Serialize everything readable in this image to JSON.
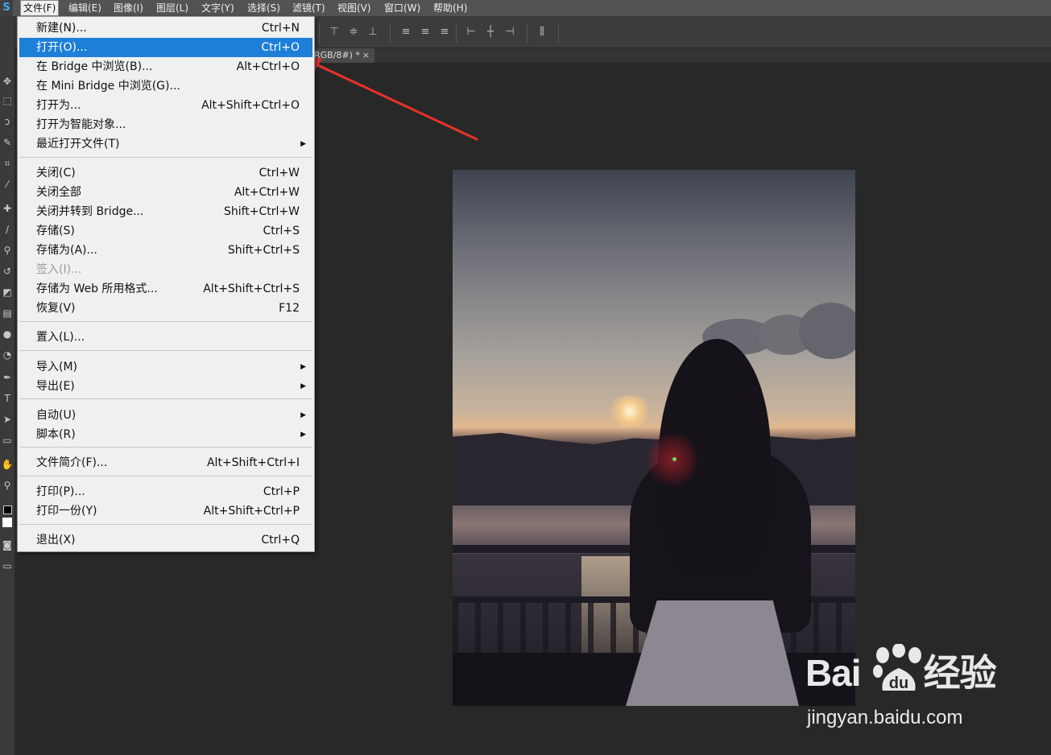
{
  "app": {
    "logo": "S"
  },
  "menubar": {
    "items": [
      {
        "label": "文件(F)",
        "active": true
      },
      {
        "label": "编辑(E)"
      },
      {
        "label": "图像(I)"
      },
      {
        "label": "图层(L)"
      },
      {
        "label": "文字(Y)"
      },
      {
        "label": "选择(S)"
      },
      {
        "label": "滤镜(T)"
      },
      {
        "label": "视图(V)"
      },
      {
        "label": "窗口(W)"
      },
      {
        "label": "帮助(H)"
      }
    ]
  },
  "document_tab": {
    "title": "RGB/8#) *",
    "close": "×"
  },
  "file_menu": {
    "items": [
      {
        "label": "新建(N)...",
        "shortcut": "Ctrl+N"
      },
      {
        "label": "打开(O)...",
        "shortcut": "Ctrl+O",
        "highlighted": true
      },
      {
        "label": "在 Bridge 中浏览(B)...",
        "shortcut": "Alt+Ctrl+O"
      },
      {
        "label": "在 Mini Bridge 中浏览(G)...",
        "shortcut": ""
      },
      {
        "label": "打开为...",
        "shortcut": "Alt+Shift+Ctrl+O"
      },
      {
        "label": "打开为智能对象...",
        "shortcut": ""
      },
      {
        "label": "最近打开文件(T)",
        "shortcut": "",
        "submenu": true
      },
      {
        "label": "关闭(C)",
        "shortcut": "Ctrl+W"
      },
      {
        "label": "关闭全部",
        "shortcut": "Alt+Ctrl+W"
      },
      {
        "label": "关闭并转到 Bridge...",
        "shortcut": "Shift+Ctrl+W"
      },
      {
        "label": "存储(S)",
        "shortcut": "Ctrl+S"
      },
      {
        "label": "存储为(A)...",
        "shortcut": "Shift+Ctrl+S"
      },
      {
        "label": "签入(I)...",
        "shortcut": "",
        "disabled": true
      },
      {
        "label": "存储为 Web 所用格式...",
        "shortcut": "Alt+Shift+Ctrl+S"
      },
      {
        "label": "恢复(V)",
        "shortcut": "F12"
      },
      {
        "label": "置入(L)...",
        "shortcut": ""
      },
      {
        "label": "导入(M)",
        "shortcut": "",
        "submenu": true
      },
      {
        "label": "导出(E)",
        "shortcut": "",
        "submenu": true
      },
      {
        "label": "自动(U)",
        "shortcut": "",
        "submenu": true
      },
      {
        "label": "脚本(R)",
        "shortcut": "",
        "submenu": true
      },
      {
        "label": "文件简介(F)...",
        "shortcut": "Alt+Shift+Ctrl+I"
      },
      {
        "label": "打印(P)...",
        "shortcut": "Ctrl+P"
      },
      {
        "label": "打印一份(Y)",
        "shortcut": "Alt+Shift+Ctrl+P"
      },
      {
        "label": "退出(X)",
        "shortcut": "Ctrl+Q"
      }
    ],
    "submenu_arrow": "▶"
  },
  "watermark": {
    "brand": "Bai  经验",
    "brand_left": "Bai",
    "brand_du": "du",
    "brand_right": "经验",
    "url": "jingyan.baidu.com"
  },
  "colors": {
    "highlight": "#1e7fd8",
    "menu_bg": "#f0f0f0",
    "annotation_arrow": "#e8322a"
  }
}
